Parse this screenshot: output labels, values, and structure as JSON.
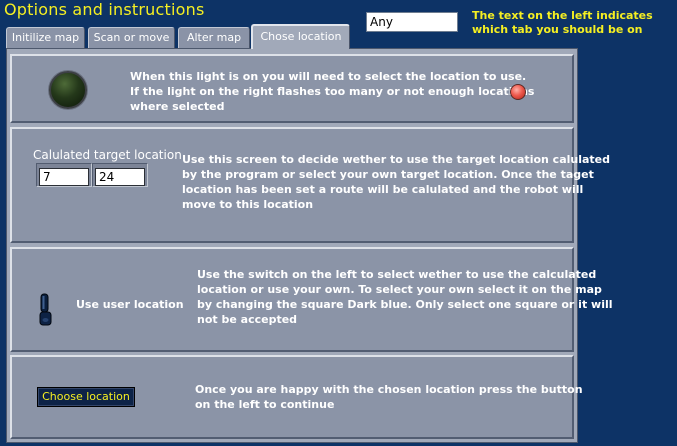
{
  "header": {
    "title": "Options and instructions",
    "tab_indicator_value": "Any",
    "hint": "The text on the left indicates which tab you should be on"
  },
  "tabs": [
    {
      "label": "Initilize map",
      "active": false
    },
    {
      "label": "Scan or move",
      "active": false
    },
    {
      "label": "Alter map",
      "active": false
    },
    {
      "label": "Chose location",
      "active": true
    }
  ],
  "panels": {
    "light": {
      "text": "When this light is on you will need to select the location to use.\nIf the light on the right flashes too many or not enough locations\nwhere selected",
      "big_light_on": false,
      "small_light_color": "#ee5a4e"
    },
    "target": {
      "label": "Calulated target location",
      "x_value": "7",
      "y_value": "24",
      "text": "Use this screen to decide wether to use the target location calulated\nby the program or select your own target location. Once the taget\nlocation has been set a route will be calulated and the robot will\nmove to this location"
    },
    "switch": {
      "label": "Use user location",
      "text": "Use the switch on the left to select wether to use the calculated\nlocation or use your own. To select your own select it on the map\nby changing the square Dark blue. Only select one square or it will\nnot be accepted"
    },
    "choose": {
      "button_label": "Choose location",
      "text": "Once you are happy with the chosen location press the button\non the left to continue"
    }
  },
  "colors": {
    "background": "#0d3366",
    "title_yellow": "#f5ef22",
    "panel": "#8b94a7",
    "button_bg": "#0d2347"
  }
}
